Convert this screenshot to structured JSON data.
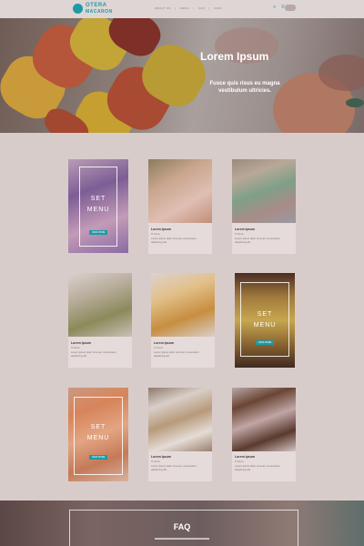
{
  "brand": {
    "name": "OTERA",
    "tagline": "MACARON"
  },
  "nav": {
    "items": [
      "ABOUT US",
      "MENU",
      "FAQ",
      "INFO"
    ]
  },
  "hero": {
    "title": "Lorem Ipsum",
    "text": "Fusce quis risus eu magna vestibulum ultricies."
  },
  "menu_overlay": {
    "title": "SET MENU",
    "button": "VIEW MORE"
  },
  "card": {
    "title": "Lorem Ipsum",
    "meta": "Ib Menu",
    "desc": "Lorem ipsum dolor sit amet, consectetur adipiscing elit."
  },
  "faq": {
    "title": "FAQ"
  },
  "colors": {
    "accent": "#1e9aa6",
    "background": "#d8cccb"
  },
  "icons": {
    "search": "search-icon",
    "menu": "menu-icon"
  }
}
